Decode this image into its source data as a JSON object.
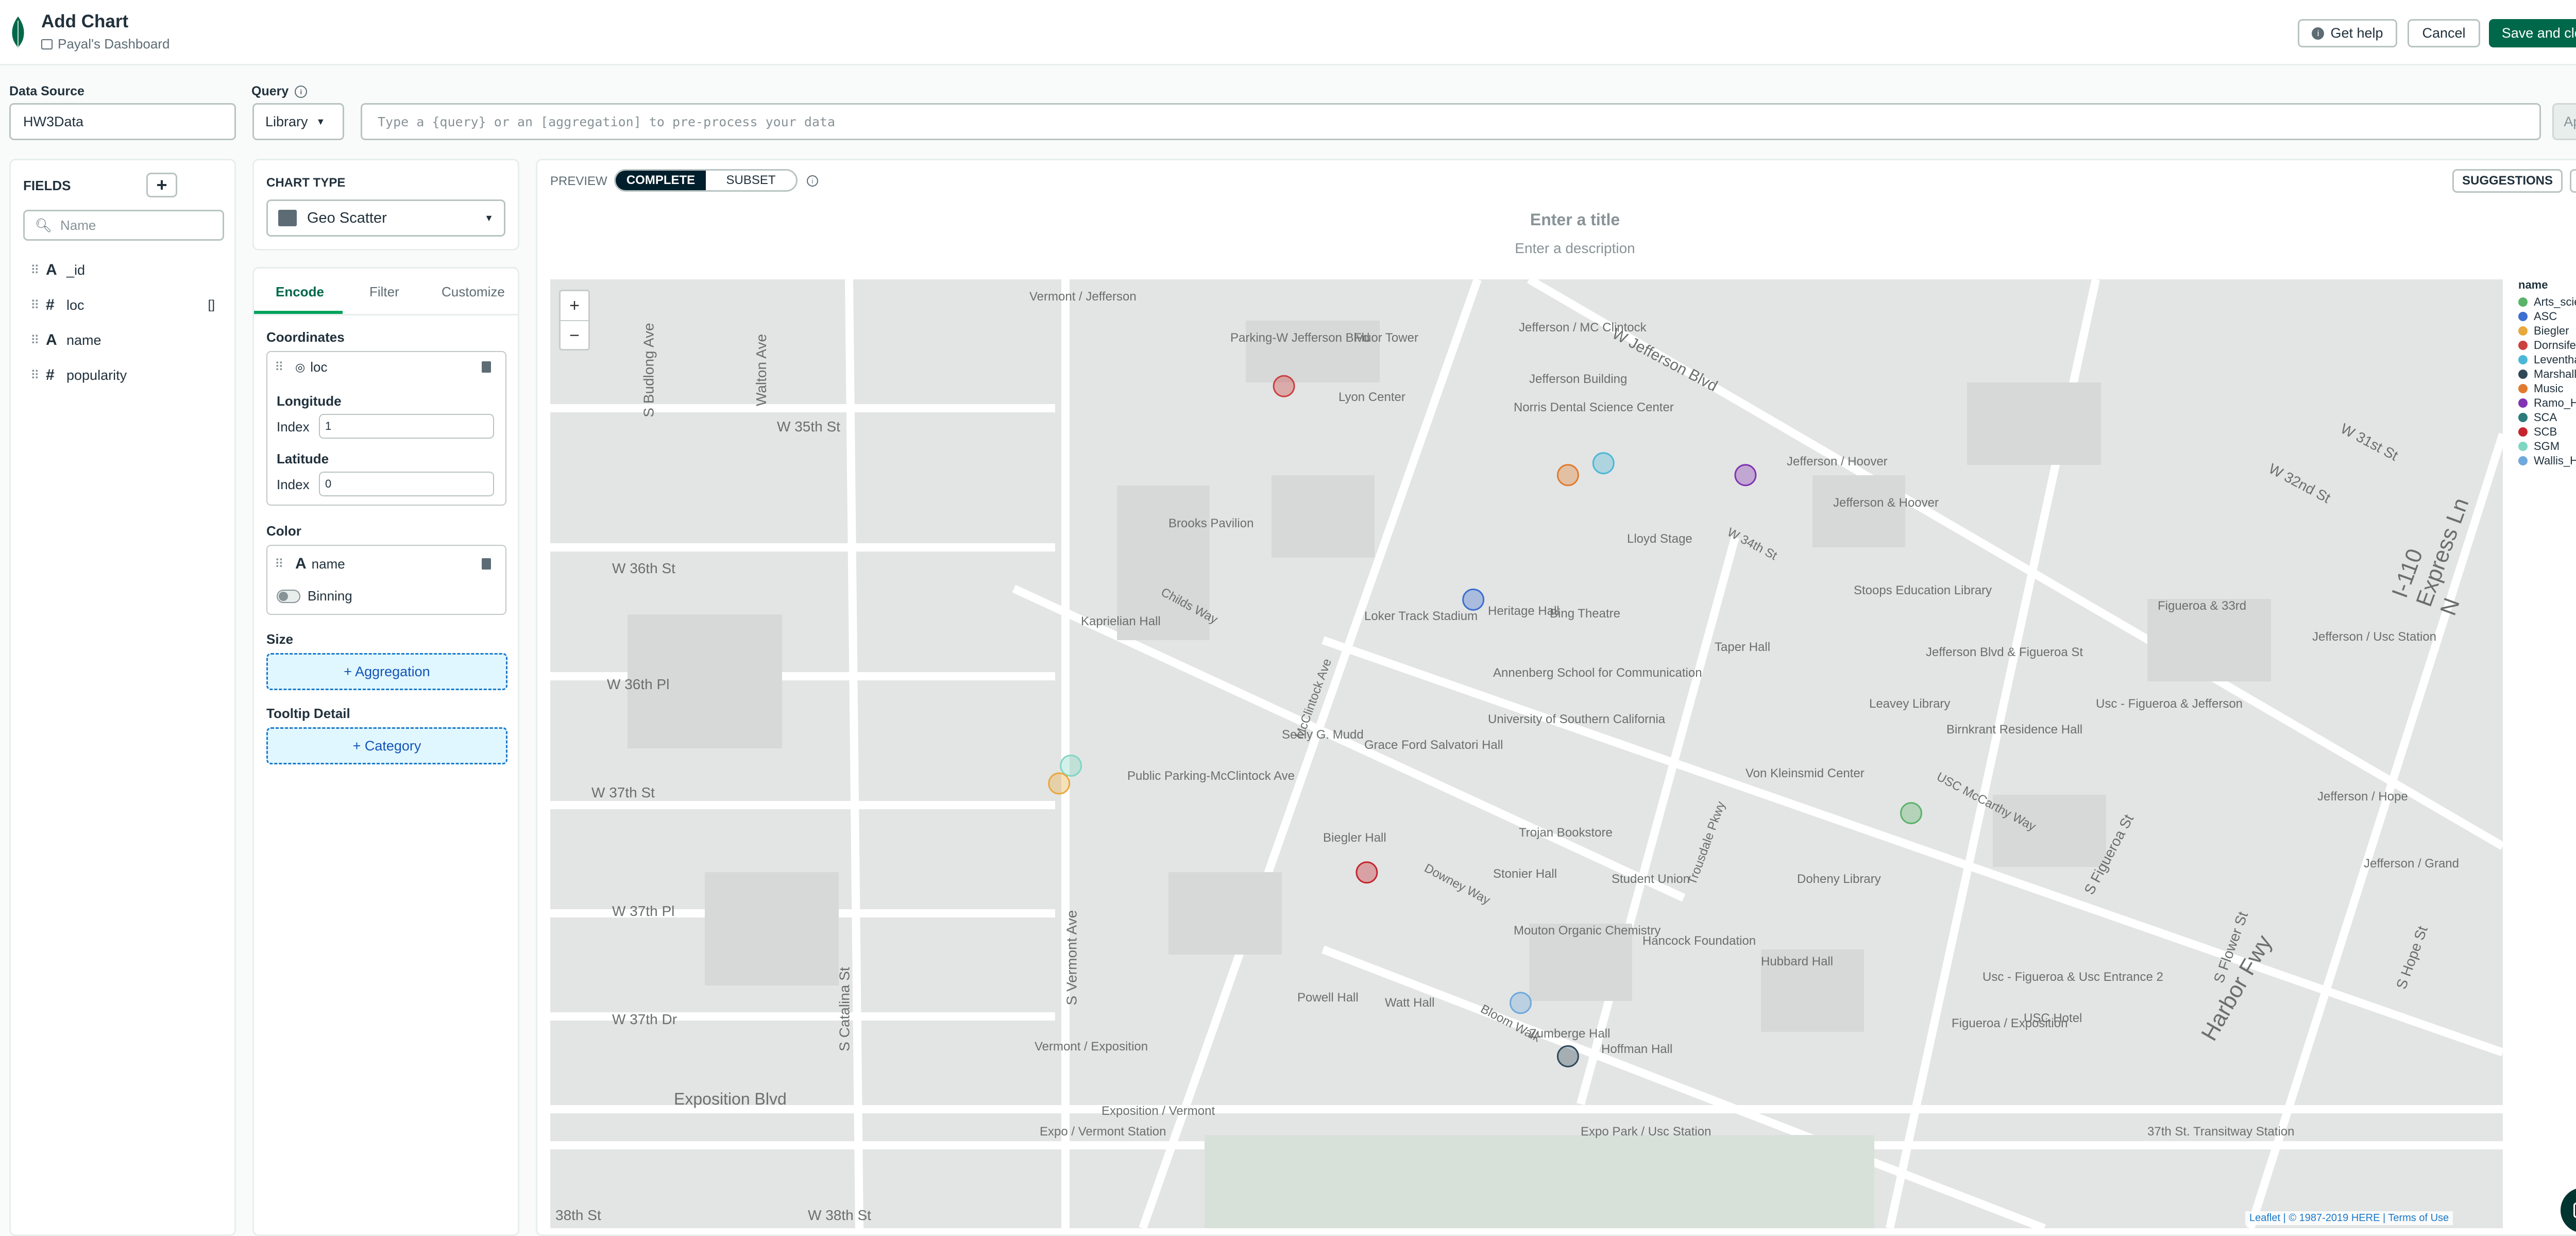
{
  "header": {
    "title": "Add Chart",
    "dashboard": "Payal's Dashboard",
    "help_label": "Get help",
    "cancel_label": "Cancel",
    "save_label": "Save and close"
  },
  "data_source": {
    "label": "Data Source",
    "value": "HW3Data"
  },
  "query": {
    "label": "Query",
    "mode": "Library",
    "placeholder": "Type a {query} or an [aggregation] to pre-process your data",
    "apply_label": "Apply"
  },
  "fields": {
    "title": "FIELDS",
    "search_placeholder": "Name",
    "items": [
      {
        "type": "A",
        "name": "_id",
        "extra": ""
      },
      {
        "type": "#",
        "name": "loc",
        "extra": "[]"
      },
      {
        "type": "A",
        "name": "name",
        "extra": ""
      },
      {
        "type": "#",
        "name": "popularity",
        "extra": ""
      }
    ]
  },
  "chart_type": {
    "title": "CHART TYPE",
    "value": "Geo Scatter"
  },
  "tabs": [
    "Encode",
    "Filter",
    "Customize"
  ],
  "encode": {
    "coordinates_label": "Coordinates",
    "coord_field": "loc",
    "longitude_label": "Longitude",
    "latitude_label": "Latitude",
    "index_label": "Index",
    "longitude_index": "1",
    "latitude_index": "0",
    "color_label": "Color",
    "color_field": "name",
    "binning_label": "Binning",
    "size_label": "Size",
    "size_button": "+ Aggregation",
    "tooltip_label": "Tooltip Detail",
    "tooltip_button": "+ Category"
  },
  "preview": {
    "label": "PREVIEW",
    "complete": "COMPLETE",
    "subset": "SUBSET",
    "suggestions": "SUGGESTIONS",
    "title_placeholder": "Enter a title",
    "desc_placeholder": "Enter a description"
  },
  "legend": {
    "title": "name",
    "items": [
      {
        "name": "Arts_science",
        "color": "#5bb36a"
      },
      {
        "name": "ASC",
        "color": "#3c6fd1"
      },
      {
        "name": "Biegler",
        "color": "#e8a83c"
      },
      {
        "name": "Dornsife",
        "color": "#cc4040"
      },
      {
        "name": "Leventhal",
        "color": "#4bb7d6"
      },
      {
        "name": "Marshall",
        "color": "#2f4858"
      },
      {
        "name": "Music",
        "color": "#e07b2e"
      },
      {
        "name": "Ramo_Hall",
        "color": "#8033b3"
      },
      {
        "name": "SCA",
        "color": "#2c7a7a"
      },
      {
        "name": "SCB",
        "color": "#c4262e"
      },
      {
        "name": "SGM",
        "color": "#7fd6c2"
      },
      {
        "name": "Wallis_Hall",
        "color": "#6fa8dc"
      }
    ]
  },
  "map": {
    "labels": [
      "Vermont / Jefferson",
      "Parking-W Jefferson Blvd",
      "Fluor Tower",
      "Lyon Center",
      "Jefferson / MC Clintock",
      "Jefferson Building",
      "Norris Dental Science Center",
      "W Jefferson Blvd",
      "W 35th St",
      "W 36th St",
      "W 36th Pl",
      "W 37th St",
      "W 37th Pl",
      "W 37th Dr",
      "Brooks Pavilion",
      "Kaprielian Hall",
      "Childs Way",
      "McClintock Ave",
      "Lloyd Stage",
      "Loker Track Stadium",
      "Heritage Hall",
      "Bing Theatre",
      "W 34th St",
      "Stoops Education Library",
      "Jefferson / Hoover",
      "Jefferson & Hoover",
      "Taper Hall",
      "Annenberg School for Communication",
      "University of Southern California",
      "Seely G. Mudd",
      "Grace Ford Salvatori Hall",
      "Public Parking-McClintock Ave",
      "Leavey Library",
      "Birnkrant Residence Hall",
      "Von Kleinsmid Center",
      "Jefferson Blvd & Figueroa St",
      "Figueroa & 33rd",
      "Jefferson / Usc Station",
      "Usc - Figueroa & Jefferson",
      "Trojan Bookstore",
      "Biegler Hall",
      "Stonier Hall",
      "Student Union",
      "Doheny Library",
      "Mouton Organic Chemistry",
      "Hancock Foundation",
      "Hubbard Hall",
      "Powell Hall",
      "Watt Hall",
      "Zumberge Hall",
      "Hoffman Hall",
      "Usc - Figueroa & Usc Entrance 2",
      "Figueroa / Exposition",
      "USC Hotel",
      "Jefferson / Hope",
      "Jefferson / Grand",
      "Exposition Blvd",
      "Vermont / Exposition",
      "Exposition / Vermont",
      "Expo / Vermont Station",
      "Expo Park / Usc Station",
      "37th St. Transitway Station",
      "W 38th St",
      "38th St",
      "Harbor Fwy",
      "I-110 Express Ln N",
      "Downey Way",
      "Bloom Walk",
      "Trousdale Pkwy",
      "USC McCarthy Way",
      "S Vermont Ave",
      "S Catalina St",
      "S Figueroa St",
      "S Hope St",
      "S Flower St",
      "W 32nd St",
      "W 31st St",
      "S Budlong Ave",
      "Walton Ave"
    ],
    "attribution": "Leaflet | © 1987-2019 HERE | Terms of Use",
    "zoom_in": "+",
    "zoom_out": "−"
  },
  "chart_data": {
    "type": "scatter",
    "x": [
      -118.2867,
      -118.2846,
      -118.2849,
      -118.2834,
      -118.2873,
      -118.2862,
      -118.2891,
      -118.2892,
      -118.282,
      -118.2866,
      -118.2855,
      -118.2851
    ],
    "y": [
      34.0222,
      34.0209,
      34.0213,
      34.0207,
      34.0186,
      34.0155,
      34.0158,
      34.016,
      34.017,
      34.014,
      34.0118,
      34.0109
    ],
    "series": [
      {
        "name": "Dornsife",
        "x": [
          -118.2873
        ],
        "y": [
          34.0222
        ]
      },
      {
        "name": "Leventhal",
        "x": [
          -118.2846
        ],
        "y": [
          34.0209
        ]
      },
      {
        "name": "Music",
        "x": [
          -118.2849
        ],
        "y": [
          34.0207
        ]
      },
      {
        "name": "Ramo_Hall",
        "x": [
          -118.2834
        ],
        "y": [
          34.0207
        ]
      },
      {
        "name": "ASC",
        "x": [
          -118.2857
        ],
        "y": [
          34.0186
        ]
      },
      {
        "name": "SGM",
        "x": [
          -118.2891
        ],
        "y": [
          34.0158
        ]
      },
      {
        "name": "Biegler",
        "x": [
          -118.2892
        ],
        "y": [
          34.0155
        ]
      },
      {
        "name": "Arts_science",
        "x": [
          -118.282
        ],
        "y": [
          34.015
        ]
      },
      {
        "name": "SCB",
        "x": [
          -118.2866
        ],
        "y": [
          34.014
        ]
      },
      {
        "name": "Wallis_Hall",
        "x": [
          -118.2853
        ],
        "y": [
          34.0118
        ]
      },
      {
        "name": "Marshall",
        "x": [
          -118.2849
        ],
        "y": [
          34.0109
        ]
      }
    ]
  }
}
